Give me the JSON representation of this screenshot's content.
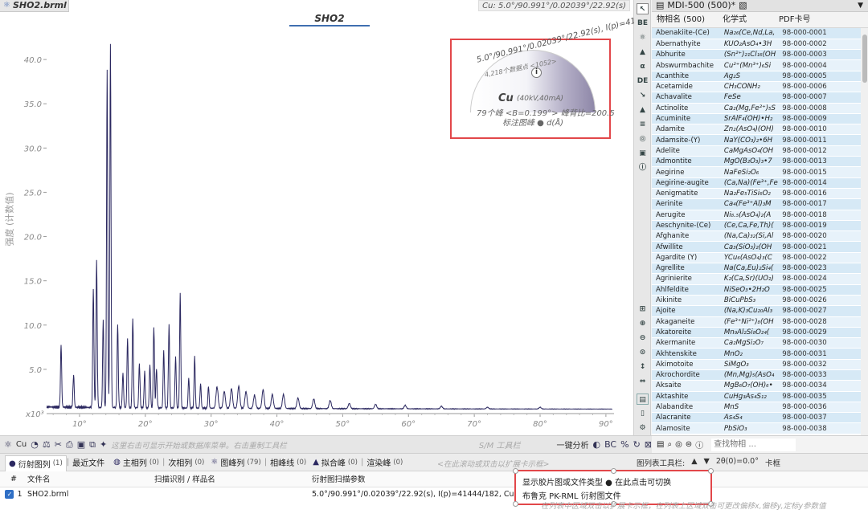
{
  "document_tab": "SHO2.brml",
  "top_info": "Cu: 5.0°/90.991°/0.02039°/22.92(s)",
  "chart_title": "SHO2",
  "chart_data": {
    "type": "line",
    "title": "SHO2",
    "ylabel": "强度 (计数值)",
    "y_multiplier": "x10³",
    "ylim": [
      0,
      44
    ],
    "xlim": [
      5.0,
      90.991
    ],
    "x_ticks": [
      "10°",
      "20°",
      "30°",
      "40°",
      "50°",
      "60°",
      "70°",
      "80°",
      "90°"
    ],
    "y_ticks": [
      "5.0",
      "10.0",
      "15.0",
      "20.0",
      "25.0",
      "30.0",
      "35.0",
      "40.0"
    ],
    "baseline": 0.5,
    "peaks": [
      {
        "x": 7.2,
        "y": 7.6
      },
      {
        "x": 9.1,
        "y": 4.2
      },
      {
        "x": 12.1,
        "y": 14.0
      },
      {
        "x": 12.6,
        "y": 17.3
      },
      {
        "x": 13.6,
        "y": 10.5
      },
      {
        "x": 14.2,
        "y": 38.5
      },
      {
        "x": 14.7,
        "y": 41.5
      },
      {
        "x": 15.8,
        "y": 10.0
      },
      {
        "x": 16.6,
        "y": 4.4
      },
      {
        "x": 17.3,
        "y": 8.4
      },
      {
        "x": 18.1,
        "y": 10.5
      },
      {
        "x": 19.1,
        "y": 5.5
      },
      {
        "x": 19.9,
        "y": 4.6
      },
      {
        "x": 20.7,
        "y": 5.4
      },
      {
        "x": 21.3,
        "y": 9.6
      },
      {
        "x": 21.7,
        "y": 5.0
      },
      {
        "x": 22.8,
        "y": 7.0
      },
      {
        "x": 23.6,
        "y": 9.9
      },
      {
        "x": 24.6,
        "y": 6.3
      },
      {
        "x": 25.3,
        "y": 13.4
      },
      {
        "x": 26.6,
        "y": 3.9
      },
      {
        "x": 27.5,
        "y": 6.3
      },
      {
        "x": 28.4,
        "y": 3.3
      },
      {
        "x": 29.6,
        "y": 3.0
      },
      {
        "x": 30.9,
        "y": 2.9
      },
      {
        "x": 32.0,
        "y": 2.4
      },
      {
        "x": 33.1,
        "y": 2.7
      },
      {
        "x": 34.2,
        "y": 3.0
      },
      {
        "x": 35.3,
        "y": 2.4
      },
      {
        "x": 36.6,
        "y": 2.0
      },
      {
        "x": 37.9,
        "y": 2.6
      },
      {
        "x": 39.3,
        "y": 2.1
      },
      {
        "x": 41.0,
        "y": 2.1
      },
      {
        "x": 43.2,
        "y": 1.7
      },
      {
        "x": 45.6,
        "y": 1.6
      },
      {
        "x": 48.1,
        "y": 1.4
      },
      {
        "x": 51.0,
        "y": 1.1
      },
      {
        "x": 55.0,
        "y": 1.0
      },
      {
        "x": 59.5,
        "y": 0.9
      },
      {
        "x": 65.0,
        "y": 0.8
      },
      {
        "x": 72.0,
        "y": 0.7
      },
      {
        "x": 80.0,
        "y": 0.7
      }
    ]
  },
  "overlay": {
    "fan_text": "5.0°/90.991°/0.02039°/22.92(s), I(p)=41444",
    "fan_sub": "4,218个数据点 <1052>",
    "info_glyph": "i",
    "radiation": "Cu",
    "mode": "(40kV,40mA)",
    "peaks_line": "79个峰 <B=0.199°> 峰背比=200.5",
    "label_line": "标注图峰 ● d(Å)"
  },
  "right_panel": {
    "title": "MDI-500 (500)*",
    "columns": [
      "物相名 (500)",
      "化学式",
      "PDF卡号"
    ],
    "rows": [
      [
        "Abenakiite-(Ce)",
        "Na₂₆(Ce,Nd,La,",
        "98-000-0001"
      ],
      [
        "Abernathyite",
        "KUO₂AsO₄•3H",
        "98-000-0002"
      ],
      [
        "Abhurite",
        "(Sn²⁺)₂₁Cl₁₆(OH",
        "98-000-0003"
      ],
      [
        "Abswurmbachite",
        "Cu²⁺(Mn³⁺)₆Si",
        "98-000-0004"
      ],
      [
        "Acanthite",
        "Ag₂S",
        "98-000-0005"
      ],
      [
        "Acetamide",
        "CH₃CONH₂",
        "98-000-0006"
      ],
      [
        "Achavalite",
        "FeSe",
        "98-000-0007"
      ],
      [
        "Actinolite",
        "Ca₂(Mg,Fe²⁺)₅S",
        "98-000-0008"
      ],
      [
        "Acuminite",
        "SrAlF₄(OH)•H₂",
        "98-000-0009"
      ],
      [
        "Adamite",
        "Zn₂(AsO₄)(OH)",
        "98-000-0010"
      ],
      [
        "Adamsite-(Y)",
        "NaY(CO₃)₂•6H",
        "98-000-0011"
      ],
      [
        "Adelite",
        "CaMgAsO₄(OH",
        "98-000-0012"
      ],
      [
        "Admontite",
        "MgO(B₂O₃)₃•7",
        "98-000-0013"
      ],
      [
        "Aegirine",
        "NaFeSi₂O₆",
        "98-000-0015"
      ],
      [
        "Aegirine-augite",
        "(Ca,Na)(Fe³⁺,Fe",
        "98-000-0014"
      ],
      [
        "Aenigmatite",
        "Na₂Fe₅TiSi₆O₂",
        "98-000-0016"
      ],
      [
        "Aerinite",
        "Ca₄(Fe³⁺Al)₃M",
        "98-000-0017"
      ],
      [
        "Aerugite",
        "Ni₈.₅(AsO₄)₂(A",
        "98-000-0018"
      ],
      [
        "Aeschynite-(Ce)",
        "(Ce,Ca,Fe,Th)(",
        "98-000-0019"
      ],
      [
        "Afghanite",
        "(Na,Ca)₃₂(Si,Al",
        "98-000-0020"
      ],
      [
        "Afwillite",
        "Ca₃(SiO₃)₂(OH",
        "98-000-0021"
      ],
      [
        "Agardite (Y)",
        "YCu₆(AsO₄)₃(C",
        "98-000-0022"
      ],
      [
        "Agrellite",
        "Na(Ca,Eu)₂Si₄(",
        "98-000-0023"
      ],
      [
        "Agrinierite",
        "K₂(Ca,Sr)(UO₂)",
        "98-000-0024"
      ],
      [
        "Ahlfeldite",
        "NiSeO₃•2H₂O",
        "98-000-0025"
      ],
      [
        "Aikinite",
        "BiCuPbS₃",
        "98-000-0026"
      ],
      [
        "Ajoite",
        "(Na,K)₃Cu₂₀Al₃",
        "98-000-0027"
      ],
      [
        "Akaganeite",
        "(Fe³⁺Ni²⁺)₈(OH",
        "98-000-0028"
      ],
      [
        "Akatoreite",
        "Mn₉Al₂Si₈O₂₄(",
        "98-000-0029"
      ],
      [
        "Akermanite",
        "Ca₂MgSi₂O₇",
        "98-000-0030"
      ],
      [
        "Akhtenskite",
        "MnO₂",
        "98-000-0031"
      ],
      [
        "Akimotoite",
        "SiMgO₃",
        "98-000-0032"
      ],
      [
        "Akrochordite",
        "(Mn,Mg)₅(AsO₄",
        "98-000-0033"
      ],
      [
        "Aksaite",
        "MgB₆O₇(OH)₆•",
        "98-000-0034"
      ],
      [
        "Aktashite",
        "CuHg₃As₄S₁₂",
        "98-000-0035"
      ],
      [
        "Alabandite",
        "MnS",
        "98-000-0036"
      ],
      [
        "Alacranite",
        "As₄S₄",
        "98-000-0037"
      ],
      [
        "Alamosite",
        "PbSiO₃",
        "98-000-0038"
      ]
    ],
    "search_placeholder": "查找物相 ..."
  },
  "chart_toolbar": {
    "radiation": "Cu",
    "hint": "这里右击可显示开始或数据库菜单。右击重制工具栏",
    "tools_label": "S/M 工具栏",
    "analysis_button": "一键分析"
  },
  "bottom": {
    "tabs": [
      {
        "label": "衍射图列",
        "count": "(1)"
      },
      {
        "label": "最近文件",
        "count": ""
      },
      {
        "label": "主相列",
        "count": "(0)"
      },
      {
        "label": "次相列",
        "count": "(0)"
      },
      {
        "label": "图峰列",
        "count": "(79)"
      },
      {
        "label": "相峰线",
        "count": "(0)"
      },
      {
        "label": "拟合峰",
        "count": "(0)"
      },
      {
        "label": "渲染峰",
        "count": "(0)"
      }
    ],
    "tab_hint": "<在此滚动或双击以扩展卡示框>",
    "right_controls": [
      "图列表工具栏:",
      "2θ(0)=0.0°",
      "卡框"
    ],
    "table_headers": [
      "#",
      "文件名",
      "扫描识别 / 样品名",
      "衍射图扫描参数"
    ],
    "rows": [
      {
        "num": "1",
        "file": "SHO2.brml",
        "sample": "",
        "params": "5.0°/90.991°/0.02039°/22.92(s), I(p)=41444/182, Cu(40kV,40mA)"
      }
    ],
    "popup_line1": "显示胶片图或文件类型 ● 在此点击可切换",
    "popup_line2": "布鲁克 PK-RML 衍射图文件",
    "bottom_hint": "在列表中区域双击以扩展卡示框，在列表上区域双击可更改偏移x,偏移y,定标y参数值"
  },
  "colors": {
    "trace": "#2b2860",
    "highlight": "#e2474a",
    "row_a": "#d6e9f6",
    "row_b": "#e7f2fa"
  }
}
